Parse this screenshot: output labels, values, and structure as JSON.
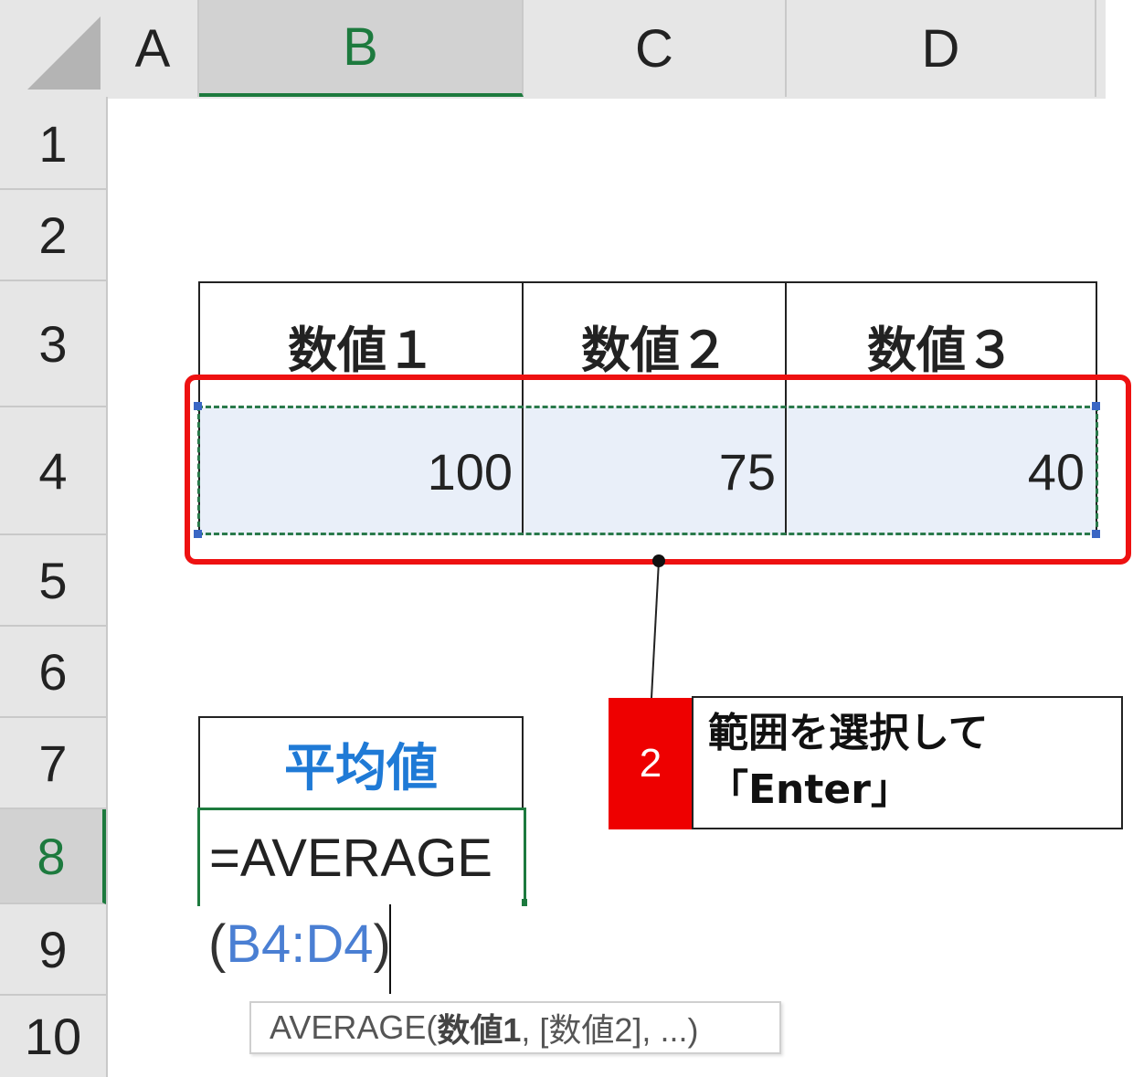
{
  "columns": [
    "A",
    "B",
    "C",
    "D"
  ],
  "rows": [
    "1",
    "2",
    "3",
    "4",
    "5",
    "6",
    "7",
    "8",
    "9",
    "10"
  ],
  "active_column": "B",
  "active_row": "8",
  "table": {
    "headers": [
      "数値１",
      "数値２",
      "数値３"
    ],
    "values": [
      "100",
      "75",
      "40"
    ]
  },
  "callout": {
    "step_number": "2",
    "line1": "範囲を選択して",
    "line2": "「Enter」"
  },
  "average": {
    "header": "平均値",
    "formula_prefix": "=AVERAGE",
    "paren_open": "(",
    "range_ref": "B4:D4",
    "paren_close": ")"
  },
  "tooltip": {
    "func_open": "AVERAGE(",
    "arg1": "数値1",
    "rest": ", [数値2], ...)"
  },
  "colors": {
    "selection_green": "#1d7a3e",
    "highlight_red": "#ee1111",
    "header_blue": "#1f7ad6",
    "ref_blue": "#4a7fd3",
    "range_fill": "#e9eff9"
  }
}
